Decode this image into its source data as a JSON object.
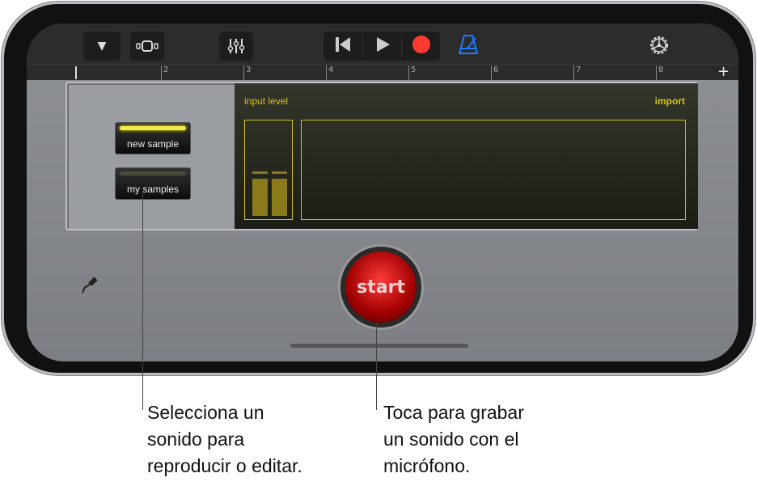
{
  "toolbar": {
    "icons": [
      "triangle-down-icon",
      "tracks-view-icon",
      "mixer-icon",
      "rewind-icon",
      "play-icon",
      "record-icon",
      "metronome-icon",
      "settings-gear-icon"
    ],
    "record_color": "#ff3b30",
    "metronome_color": "#1a7cff"
  },
  "ruler": {
    "marks": [
      "2",
      "3",
      "4",
      "5",
      "6",
      "7",
      "8"
    ],
    "add": "+"
  },
  "sampler": {
    "new_sample": "new sample",
    "my_samples": "my samples",
    "input_level": "input level",
    "import": "import",
    "start": "start",
    "accent": "#d6c21d"
  },
  "callouts": {
    "left": [
      "Selecciona un",
      "sonido para",
      "reproducir o editar."
    ],
    "right": [
      "Toca para grabar",
      "un sonido con el",
      "micrófono."
    ]
  }
}
